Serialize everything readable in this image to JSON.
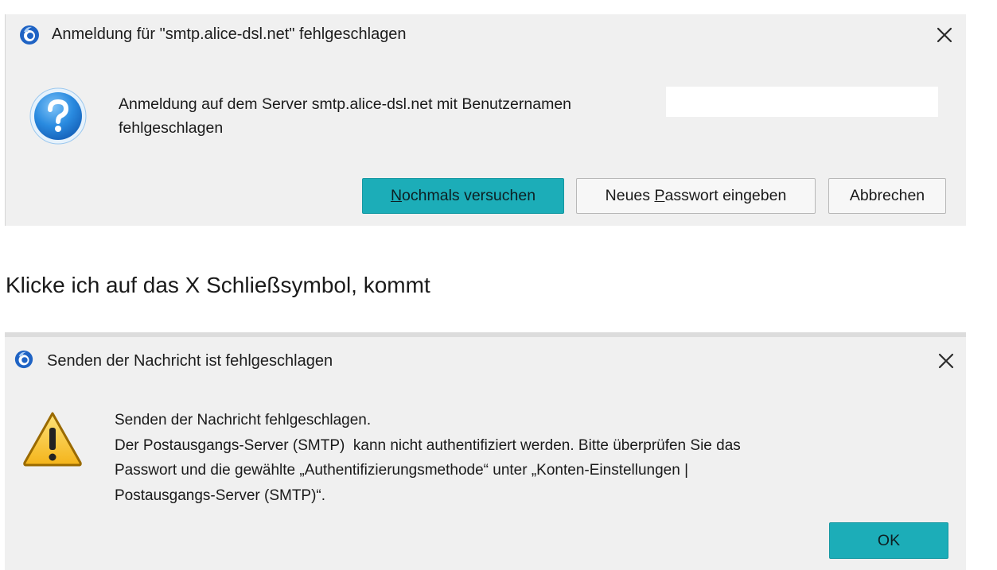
{
  "dialog1": {
    "title": "Anmeldung für \"smtp.alice-dsl.net\" fehlgeschlagen",
    "message_line1": "Anmeldung auf dem Server smtp.alice-dsl.net mit Benutzernamen",
    "message_line2": "fehlgeschlagen",
    "buttons": {
      "retry": {
        "mnemonic": "N",
        "rest": "ochmals versuchen"
      },
      "new_password": {
        "before": "Neues ",
        "mnemonic": "P",
        "after": "asswort eingeben"
      },
      "cancel": "Abbrechen"
    },
    "icon": "question-icon",
    "accent_color": "#1cadb8"
  },
  "between_text": "Klicke ich auf das X Schließsymbol, kommt",
  "dialog2": {
    "title": "Senden der Nachricht ist fehlgeschlagen",
    "message_lines": [
      "Senden der Nachricht fehlgeschlagen.",
      "Der Postausgangs-Server (SMTP)  kann nicht authentifiziert werden. Bitte überprüfen Sie das",
      "Passwort und die gewählte „Authentifizierungsmethode“ unter „Konten-Einstellungen |",
      "Postausgangs-Server (SMTP)“."
    ],
    "ok_label": "OK",
    "icon": "warning-icon",
    "accent_color": "#1cadb8"
  }
}
